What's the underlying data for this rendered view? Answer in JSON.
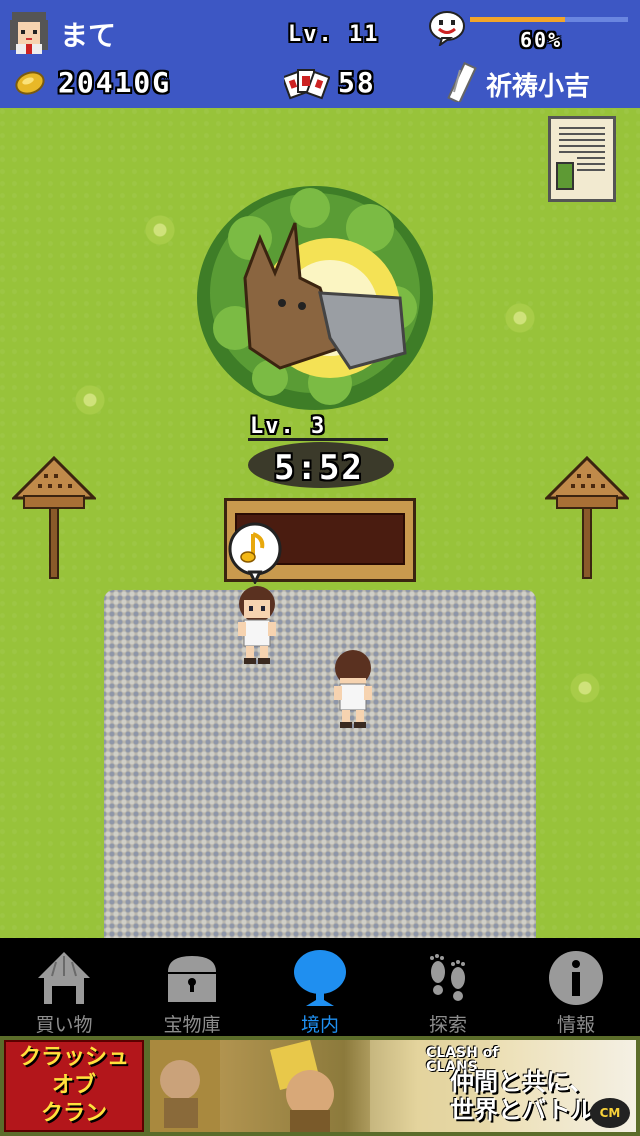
{
  "player": {
    "name": "まて",
    "level": "Lv. 11",
    "gold": "20410G",
    "cards": "58",
    "progress_pct": 60,
    "progress_label": "60%",
    "fortune": "祈祷小吉"
  },
  "tree": {
    "level": "Lv. 3",
    "timer": "5:52"
  },
  "nav": {
    "items": [
      {
        "label": "買い物",
        "icon": "shop-icon"
      },
      {
        "label": "宝物庫",
        "icon": "treasure-chest-icon"
      },
      {
        "label": "境内",
        "icon": "tree-icon",
        "active": true
      },
      {
        "label": "探索",
        "icon": "footprints-icon"
      },
      {
        "label": "情報",
        "icon": "info-icon"
      }
    ]
  },
  "ad": {
    "left_text": "クラッシュ\nオブ\nクラン",
    "logo_text": "CLASH of CLANS",
    "tagline": "仲間と共に、\n世界とバトル",
    "badge": "CM"
  },
  "colors": {
    "hud_bg": "#3d57c4",
    "grass": "#98c33a",
    "active_tab": "#1f8ff0",
    "inactive_tab": "#8d8d8d",
    "progress_fill": "#f2a52a"
  }
}
